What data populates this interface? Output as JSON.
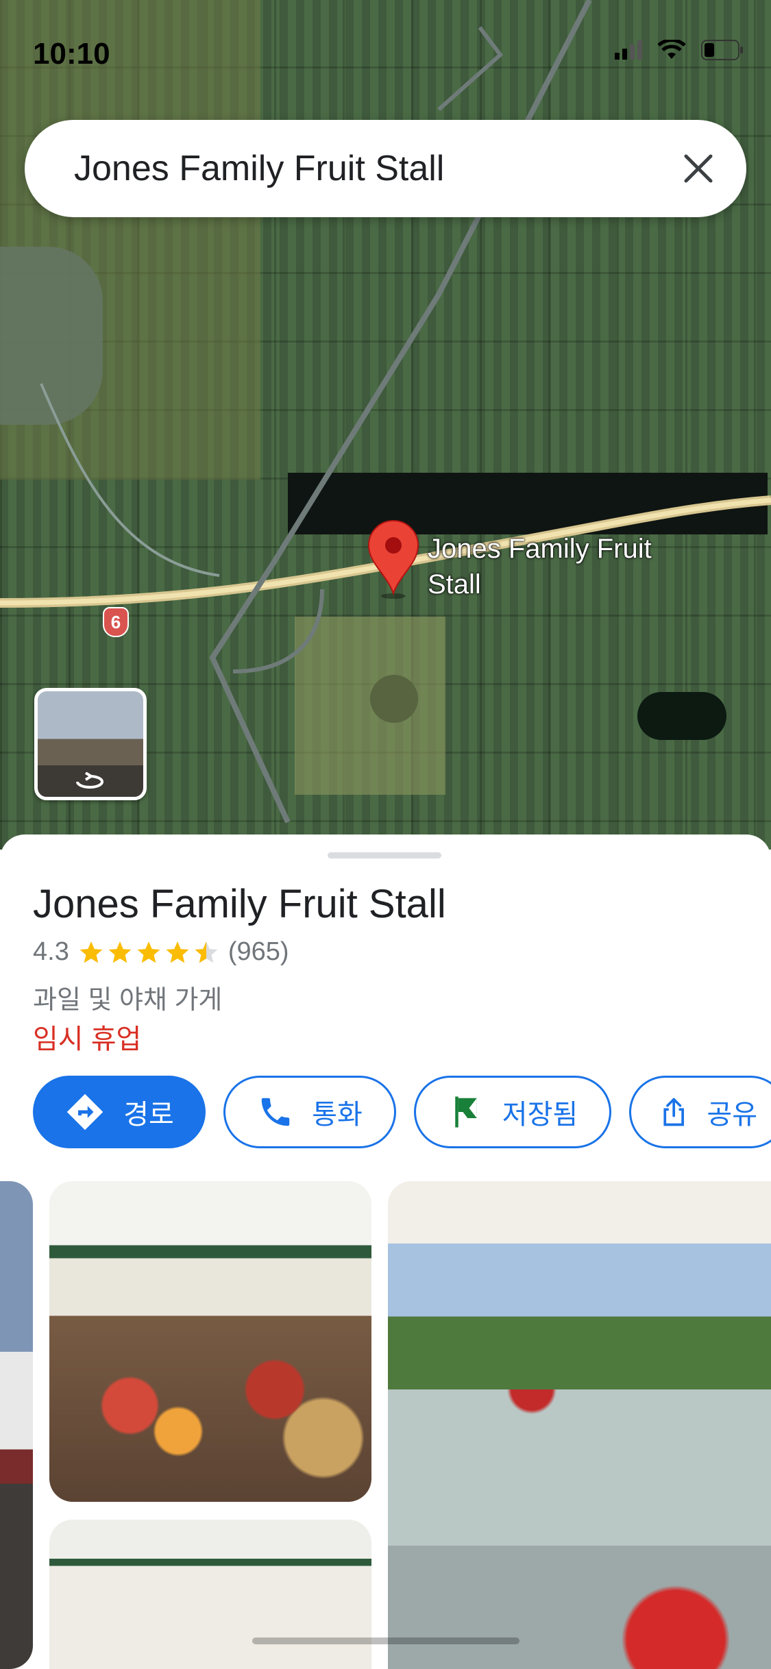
{
  "status_bar": {
    "time": "10:10"
  },
  "search": {
    "query": "Jones Family Fruit Stall"
  },
  "map": {
    "pin_label_line1": "Jones Family Fruit",
    "pin_label_line2": "Stall",
    "highway_shield": "6"
  },
  "place": {
    "title": "Jones Family Fruit Stall",
    "rating": "4.3",
    "rating_value": 4.3,
    "review_count": "(965)",
    "category": "과일 및 야채 가게",
    "status": "임시 휴업"
  },
  "actions": {
    "directions": "경로",
    "call": "통화",
    "saved": "저장됨",
    "share": "공유"
  },
  "colors": {
    "accent": "#1a73e8",
    "closed": "#d93025",
    "star": "#fbbc04",
    "pin": "#ea4335"
  }
}
